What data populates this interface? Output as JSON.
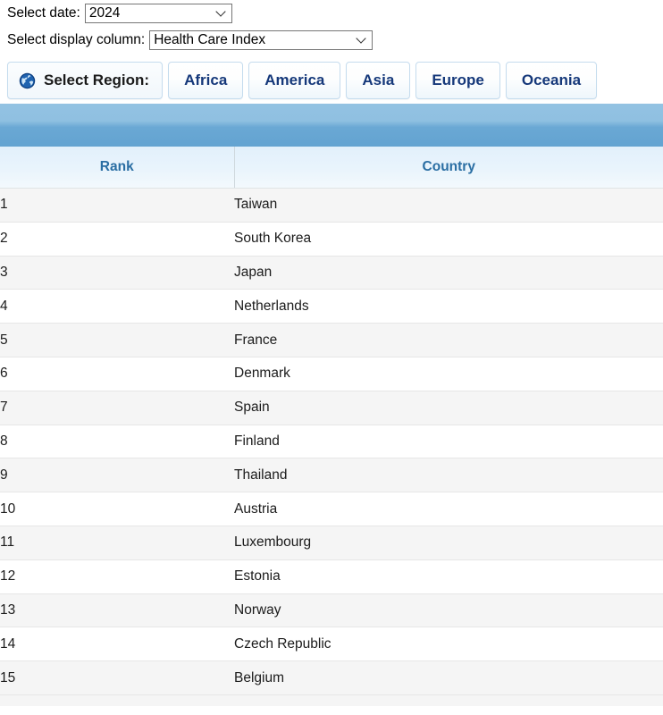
{
  "filters": {
    "date": {
      "label": "Select date:",
      "value": "2024",
      "icon": "chevron-down-icon"
    },
    "display_column": {
      "label": "Select display column:",
      "value": "Health Care Index",
      "icon": "chevron-down-icon"
    }
  },
  "region_bar": {
    "icon": "globe-icon",
    "label": "Select Region:",
    "buttons": [
      {
        "label": "Africa"
      },
      {
        "label": "America"
      },
      {
        "label": "Asia"
      },
      {
        "label": "Europe"
      },
      {
        "label": "Oceania"
      }
    ]
  },
  "table": {
    "headers": {
      "rank": "Rank",
      "country": "Country"
    },
    "rows": [
      {
        "rank": "1",
        "country": "Taiwan"
      },
      {
        "rank": "2",
        "country": "South Korea"
      },
      {
        "rank": "3",
        "country": "Japan"
      },
      {
        "rank": "4",
        "country": "Netherlands"
      },
      {
        "rank": "5",
        "country": "France"
      },
      {
        "rank": "6",
        "country": "Denmark"
      },
      {
        "rank": "7",
        "country": "Spain"
      },
      {
        "rank": "8",
        "country": "Finland"
      },
      {
        "rank": "9",
        "country": "Thailand"
      },
      {
        "rank": "10",
        "country": "Austria"
      },
      {
        "rank": "11",
        "country": "Luxembourg"
      },
      {
        "rank": "12",
        "country": "Estonia"
      },
      {
        "rank": "13",
        "country": "Norway"
      },
      {
        "rank": "14",
        "country": "Czech Republic"
      },
      {
        "rank": "15",
        "country": "Belgium"
      }
    ]
  },
  "colors": {
    "band_blue": "#6aa8d4",
    "header_text_blue": "#2a6ea3",
    "button_text_navy": "#15387a",
    "row_alt_gray": "#f5f5f5"
  }
}
